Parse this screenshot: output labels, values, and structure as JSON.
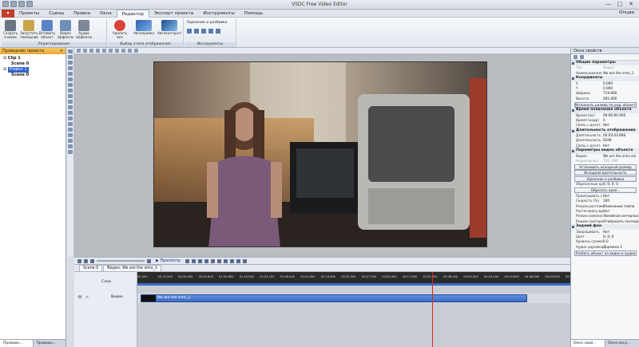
{
  "window": {
    "title": "VSDC Free Video Editor"
  },
  "menu": {
    "tabs": [
      "Проекты",
      "Сцены",
      "Правка",
      "Окна",
      "Редактор",
      "Экспорт проекта",
      "Инструменты",
      "Помощь"
    ],
    "active": "Редактор",
    "options": "Опции"
  },
  "ribbon": {
    "buttons": [
      {
        "label": "Создать снимок"
      },
      {
        "label": "Запустить помощник"
      },
      {
        "label": "Вставить объект"
      },
      {
        "label": "Видео эффекты"
      },
      {
        "label": "Аудио эффекты"
      },
      {
        "label": "Удалить все"
      },
      {
        "label": "Автоправка"
      },
      {
        "label": "Автоконтраст"
      }
    ],
    "groups": [
      "Редактирование",
      "Выбор стиля отображения",
      "Инструменты"
    ],
    "tools_title": "Удаление и разбивка"
  },
  "left_panel": {
    "title": "Проводник проекта",
    "tree": [
      "Clip 1",
      "Scene 0",
      "Project 1",
      "Scene 0"
    ],
    "tabs": [
      "Проводн...",
      "Проводн..."
    ]
  },
  "timeline": {
    "preview_label": "Просмотр",
    "scene_tabs": [
      "Scene 0",
      "Видео: We are the sims_1"
    ],
    "layer_header": "Слои",
    "track_name": "Видео",
    "clip_label": "We are the sims_1",
    "ticks": [
      "00.000",
      "00:15.200",
      "00:30.400",
      "00:45.600",
      "01:00.800",
      "01:16.000",
      "01:31.200",
      "01:46.400",
      "02:01.600",
      "02:16.800",
      "02:32.000",
      "02:47.200",
      "03:02.400",
      "03:17.600",
      "03:32.800",
      "03:48.000",
      "04:03.200",
      "04:18.400",
      "04:33.600",
      "04:48.800",
      "05:04.000",
      "05:19.200"
    ]
  },
  "properties": {
    "title": "Окно свойств",
    "sections": [
      {
        "name": "Общие параметры",
        "rows": [
          [
            "Тип",
            "Видео",
            true
          ],
          [
            "Наименование",
            "We are the sims_1",
            false
          ]
        ]
      },
      {
        "name": "Координаты",
        "rows": [
          [
            "X",
            "0.000",
            false
          ],
          [
            "Y",
            "0.000",
            false
          ],
          [
            "Ширина",
            "719.000",
            false
          ],
          [
            "Высота",
            "481.000",
            false
          ]
        ],
        "button": "Исполнить размер по род. объекту"
      },
      {
        "name": "Время появления объекта",
        "rows": [
          [
            "Время (мс)",
            "00:00:00.000",
            false
          ],
          [
            "Время (кадр)",
            "0",
            false
          ],
          [
            "Связь с дочет.",
            "Нет",
            false
          ]
        ]
      },
      {
        "name": "Длительность отображения",
        "rows": [
          [
            "Длительность",
            "00:03:03.666",
            false
          ],
          [
            "Длительность",
            "9108",
            false
          ],
          [
            "Связь с дочет.",
            "Нет",
            false
          ]
        ]
      },
      {
        "name": "Параметры видео объекта",
        "rows": [
          [
            "Видео",
            "We are the sims.avi",
            false
          ],
          [
            "Нормальные",
            "720, 480",
            true
          ]
        ],
        "buttons": [
          "Установить исходный размер",
          "Исходная длительность",
          "Удаление и разбивка"
        ]
      },
      {
        "name": "",
        "rows": [
          [
            "Обрезанные кра",
            "0; 0; 0; 0",
            false
          ]
        ],
        "buttons": [
          "Обрезать края..."
        ]
      },
      {
        "name": "",
        "rows": [
          [
            "Проигрывать с",
            "Нет",
            false
          ],
          [
            "Скорость (%)",
            "100",
            false
          ],
          [
            "Режим растяжен.",
            "Изменение темпа",
            false
          ],
          [
            "Растягивать вы",
            "Нет",
            false
          ],
          [
            "Режим изменени",
            "Линейная интерпол.",
            false
          ],
          [
            "Режим повторен",
            "Отобразить последн.",
            false
          ]
        ]
      },
      {
        "name": "Задний фон",
        "rows": [
          [
            "Закрашивать",
            "Нет",
            false
          ],
          [
            "Цвет",
            "0; 0; 0",
            false
          ],
          [
            "Уровень громко",
            "0.0",
            false
          ],
          [
            "Аудио дорожка",
            "Дорожка 1",
            false
          ]
        ],
        "buttons": [
          "Разбить объект на видео и аудио"
        ]
      }
    ],
    "tabs": [
      "Окно свой...",
      "Окно ресу..."
    ]
  }
}
